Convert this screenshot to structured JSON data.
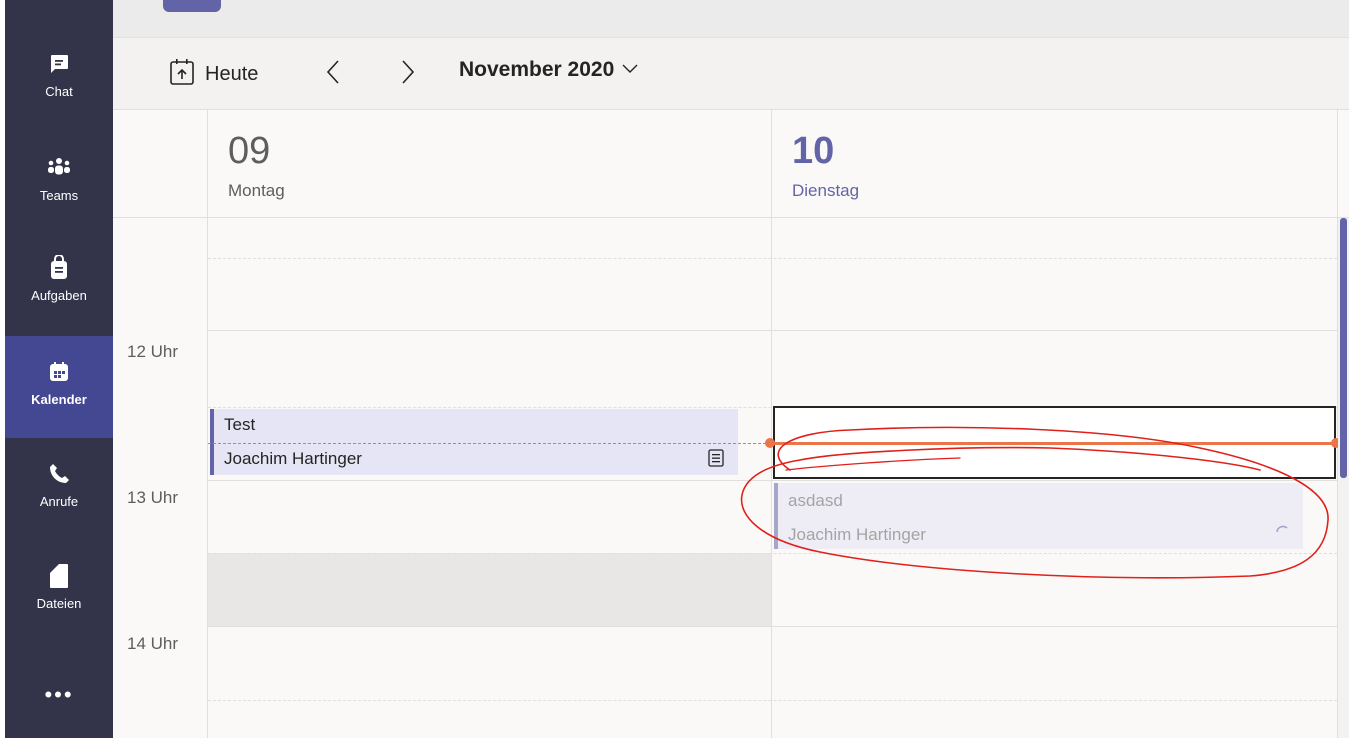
{
  "rail": {
    "items": [
      {
        "label": "Chat",
        "icon": "chat-icon"
      },
      {
        "label": "Teams",
        "icon": "teams-icon"
      },
      {
        "label": "Aufgaben",
        "icon": "tasks-icon"
      },
      {
        "label": "Kalender",
        "icon": "calendar-icon",
        "active": true
      },
      {
        "label": "Anrufe",
        "icon": "phone-icon"
      },
      {
        "label": "Dateien",
        "icon": "file-icon"
      }
    ],
    "more_label": "•••"
  },
  "toolbar": {
    "today_label": "Heute",
    "month_label": "November 2020"
  },
  "days": [
    {
      "number": "09",
      "name": "Montag"
    },
    {
      "number": "10",
      "name": "Dienstag",
      "is_today": true
    }
  ],
  "hours": [
    "12 Uhr",
    "13 Uhr",
    "14 Uhr"
  ],
  "events": [
    {
      "title": "Test",
      "organizer": "Joachim Hartinger"
    },
    {
      "title": "asdasd",
      "organizer": "Joachim Hartinger"
    }
  ],
  "colors": {
    "rail_bg": "#33344a",
    "accent": "#6264a7",
    "now_line": "#e97548",
    "annotation": "#e0201b"
  }
}
